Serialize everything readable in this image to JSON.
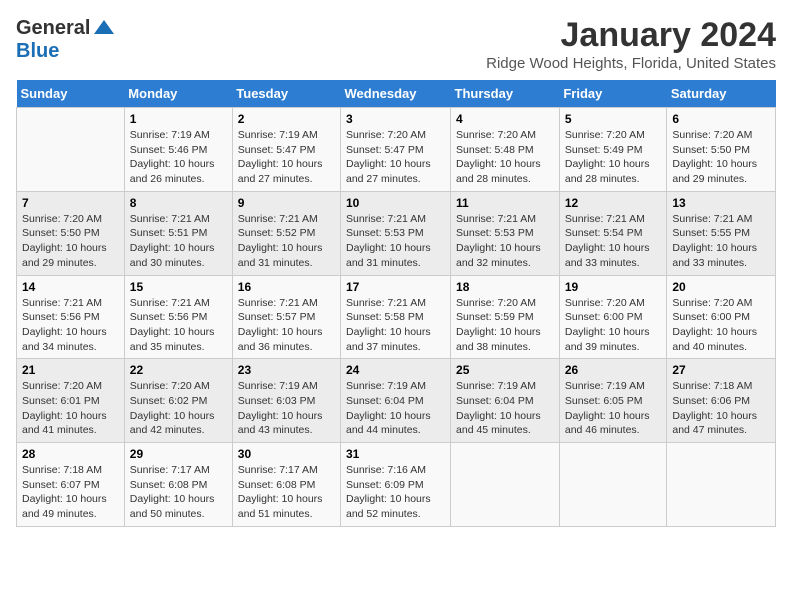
{
  "logo": {
    "general": "General",
    "blue": "Blue"
  },
  "title": "January 2024",
  "subtitle": "Ridge Wood Heights, Florida, United States",
  "days_header": [
    "Sunday",
    "Monday",
    "Tuesday",
    "Wednesday",
    "Thursday",
    "Friday",
    "Saturday"
  ],
  "weeks": [
    [
      {
        "day": "",
        "info": ""
      },
      {
        "day": "1",
        "info": "Sunrise: 7:19 AM\nSunset: 5:46 PM\nDaylight: 10 hours\nand 26 minutes."
      },
      {
        "day": "2",
        "info": "Sunrise: 7:19 AM\nSunset: 5:47 PM\nDaylight: 10 hours\nand 27 minutes."
      },
      {
        "day": "3",
        "info": "Sunrise: 7:20 AM\nSunset: 5:47 PM\nDaylight: 10 hours\nand 27 minutes."
      },
      {
        "day": "4",
        "info": "Sunrise: 7:20 AM\nSunset: 5:48 PM\nDaylight: 10 hours\nand 28 minutes."
      },
      {
        "day": "5",
        "info": "Sunrise: 7:20 AM\nSunset: 5:49 PM\nDaylight: 10 hours\nand 28 minutes."
      },
      {
        "day": "6",
        "info": "Sunrise: 7:20 AM\nSunset: 5:50 PM\nDaylight: 10 hours\nand 29 minutes."
      }
    ],
    [
      {
        "day": "7",
        "info": "Sunrise: 7:20 AM\nSunset: 5:50 PM\nDaylight: 10 hours\nand 29 minutes."
      },
      {
        "day": "8",
        "info": "Sunrise: 7:21 AM\nSunset: 5:51 PM\nDaylight: 10 hours\nand 30 minutes."
      },
      {
        "day": "9",
        "info": "Sunrise: 7:21 AM\nSunset: 5:52 PM\nDaylight: 10 hours\nand 31 minutes."
      },
      {
        "day": "10",
        "info": "Sunrise: 7:21 AM\nSunset: 5:53 PM\nDaylight: 10 hours\nand 31 minutes."
      },
      {
        "day": "11",
        "info": "Sunrise: 7:21 AM\nSunset: 5:53 PM\nDaylight: 10 hours\nand 32 minutes."
      },
      {
        "day": "12",
        "info": "Sunrise: 7:21 AM\nSunset: 5:54 PM\nDaylight: 10 hours\nand 33 minutes."
      },
      {
        "day": "13",
        "info": "Sunrise: 7:21 AM\nSunset: 5:55 PM\nDaylight: 10 hours\nand 33 minutes."
      }
    ],
    [
      {
        "day": "14",
        "info": "Sunrise: 7:21 AM\nSunset: 5:56 PM\nDaylight: 10 hours\nand 34 minutes."
      },
      {
        "day": "15",
        "info": "Sunrise: 7:21 AM\nSunset: 5:56 PM\nDaylight: 10 hours\nand 35 minutes."
      },
      {
        "day": "16",
        "info": "Sunrise: 7:21 AM\nSunset: 5:57 PM\nDaylight: 10 hours\nand 36 minutes."
      },
      {
        "day": "17",
        "info": "Sunrise: 7:21 AM\nSunset: 5:58 PM\nDaylight: 10 hours\nand 37 minutes."
      },
      {
        "day": "18",
        "info": "Sunrise: 7:20 AM\nSunset: 5:59 PM\nDaylight: 10 hours\nand 38 minutes."
      },
      {
        "day": "19",
        "info": "Sunrise: 7:20 AM\nSunset: 6:00 PM\nDaylight: 10 hours\nand 39 minutes."
      },
      {
        "day": "20",
        "info": "Sunrise: 7:20 AM\nSunset: 6:00 PM\nDaylight: 10 hours\nand 40 minutes."
      }
    ],
    [
      {
        "day": "21",
        "info": "Sunrise: 7:20 AM\nSunset: 6:01 PM\nDaylight: 10 hours\nand 41 minutes."
      },
      {
        "day": "22",
        "info": "Sunrise: 7:20 AM\nSunset: 6:02 PM\nDaylight: 10 hours\nand 42 minutes."
      },
      {
        "day": "23",
        "info": "Sunrise: 7:19 AM\nSunset: 6:03 PM\nDaylight: 10 hours\nand 43 minutes."
      },
      {
        "day": "24",
        "info": "Sunrise: 7:19 AM\nSunset: 6:04 PM\nDaylight: 10 hours\nand 44 minutes."
      },
      {
        "day": "25",
        "info": "Sunrise: 7:19 AM\nSunset: 6:04 PM\nDaylight: 10 hours\nand 45 minutes."
      },
      {
        "day": "26",
        "info": "Sunrise: 7:19 AM\nSunset: 6:05 PM\nDaylight: 10 hours\nand 46 minutes."
      },
      {
        "day": "27",
        "info": "Sunrise: 7:18 AM\nSunset: 6:06 PM\nDaylight: 10 hours\nand 47 minutes."
      }
    ],
    [
      {
        "day": "28",
        "info": "Sunrise: 7:18 AM\nSunset: 6:07 PM\nDaylight: 10 hours\nand 49 minutes."
      },
      {
        "day": "29",
        "info": "Sunrise: 7:17 AM\nSunset: 6:08 PM\nDaylight: 10 hours\nand 50 minutes."
      },
      {
        "day": "30",
        "info": "Sunrise: 7:17 AM\nSunset: 6:08 PM\nDaylight: 10 hours\nand 51 minutes."
      },
      {
        "day": "31",
        "info": "Sunrise: 7:16 AM\nSunset: 6:09 PM\nDaylight: 10 hours\nand 52 minutes."
      },
      {
        "day": "",
        "info": ""
      },
      {
        "day": "",
        "info": ""
      },
      {
        "day": "",
        "info": ""
      }
    ]
  ]
}
